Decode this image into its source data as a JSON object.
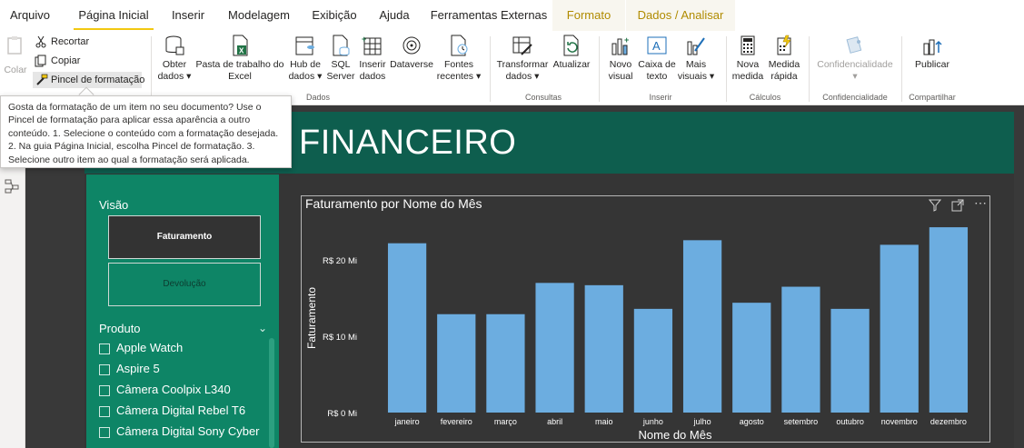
{
  "tabs": [
    "Arquivo",
    "Página Inicial",
    "Inserir",
    "Modelagem",
    "Exibição",
    "Ajuda",
    "Ferramentas Externas",
    "Formato",
    "Dados / Analisar"
  ],
  "clipboard": {
    "colar": "Colar",
    "recortar": "Recortar",
    "copiar": "Copiar",
    "pincel": "Pincel de formatação"
  },
  "dados_group": {
    "label": "Dados",
    "obter": [
      "Obter",
      "dados ▾"
    ],
    "pasta": [
      "Pasta de trabalho do",
      "Excel"
    ],
    "hub": [
      "Hub de",
      "dados ▾"
    ],
    "sql": [
      "SQL",
      "Server"
    ],
    "inserir": [
      "Inserir",
      "dados"
    ],
    "dataverse": "Dataverse",
    "fontes": [
      "Fontes",
      "recentes ▾"
    ]
  },
  "consultas_group": {
    "label": "Consultas",
    "transformar": [
      "Transformar",
      "dados ▾"
    ],
    "atualizar": "Atualizar"
  },
  "inserir_group": {
    "label": "Inserir",
    "novo": [
      "Novo",
      "visual"
    ],
    "caixa": [
      "Caixa de",
      "texto"
    ],
    "mais": [
      "Mais",
      "visuais ▾"
    ]
  },
  "calculos_group": {
    "label": "Cálculos",
    "nova": [
      "Nova",
      "medida"
    ],
    "rapida": [
      "Medida",
      "rápida"
    ]
  },
  "conf_group": {
    "label": "Confidencialidade",
    "btn": "Confidencialidade",
    "caret": "▾"
  },
  "compartilhar_group": {
    "label": "Compartilhar",
    "publicar": "Publicar"
  },
  "tooltip": {
    "line1": "Gosta da formatação de um item no seu documento? Use o",
    "line2": "Pincel de formatação para aplicar essa aparência a outro",
    "line3": "conteúdo. 1. Selecione o conteúdo com a formatação desejada.",
    "line4": "2. Na guia Página Inicial, escolha Pincel de formatação. 3.",
    "line5": "Selecione outro item ao qual a formatação será aplicada."
  },
  "report": {
    "title": "FINANCEIRO",
    "visao_label": "Visão",
    "visao_buttons": [
      "Faturamento",
      "Devolução"
    ],
    "produto_label": "Produto",
    "produtos": [
      "Apple Watch",
      "Aspire 5",
      "Câmera Coolpix L340",
      "Câmera Digital Rebel T6",
      "Câmera Digital Sony Cyber"
    ]
  },
  "colors": {
    "header": "#0e5e4e",
    "sidepanel": "#0e8566",
    "bar": "#6cade0",
    "accent": "#f2c811"
  },
  "chart_data": {
    "type": "bar",
    "title": "Faturamento por Nome do Mês",
    "xlabel": "Nome do Mês",
    "ylabel": "Faturamento",
    "categories": [
      "janeiro",
      "fevereiro",
      "março",
      "abril",
      "maio",
      "junho",
      "julho",
      "agosto",
      "setembro",
      "outubro",
      "novembro",
      "dezembro"
    ],
    "values": [
      22.2,
      12.9,
      12.9,
      17.0,
      16.7,
      13.6,
      22.6,
      14.4,
      16.5,
      13.6,
      22.0,
      24.3
    ],
    "yticks": [
      {
        "value": 0,
        "label": "R$ 0 Mi"
      },
      {
        "value": 10,
        "label": "R$ 10 Mi"
      },
      {
        "value": 20,
        "label": "R$ 20 Mi"
      }
    ],
    "ylim": [
      0,
      25.5
    ],
    "unit": "R$ Mi",
    "grid": false
  }
}
